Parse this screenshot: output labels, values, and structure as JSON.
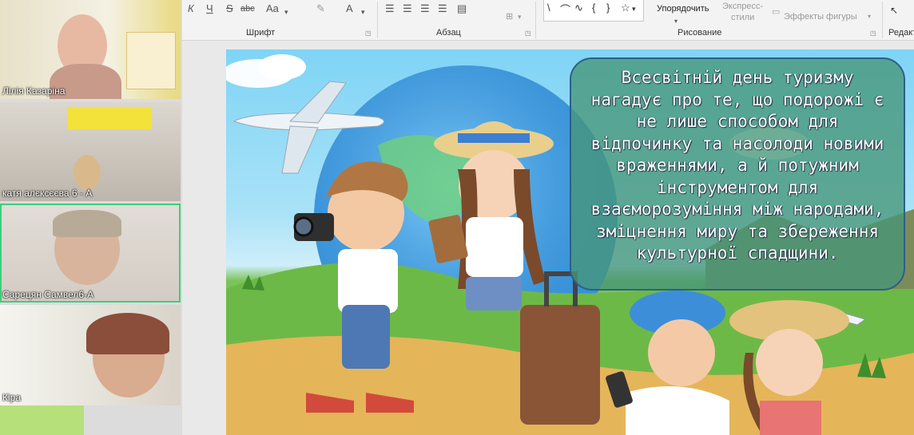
{
  "ribbon": {
    "font_group": "Шрифт",
    "paragraph_group": "Абзац",
    "drawing_group": "Рисование",
    "editing_group": "Редакт",
    "arrange_label": "Упорядочить",
    "quick_styles_label": "Экспресс-\nстили",
    "shape_effects_label": "Эффекты фигуры",
    "font_tools": [
      "К",
      "Ч",
      "S",
      "abc",
      "Aa",
      "A"
    ]
  },
  "participants": [
    {
      "name": "Лілія Казаріна"
    },
    {
      "name": "катя алєксєєва 6 - А"
    },
    {
      "name": "Сарецян Самвел6-А"
    },
    {
      "name": "Кіра"
    }
  ],
  "slide": {
    "text": "Всесвітній день туризму нагадує про те, що подорожі є не лише способом для відпочинку та насолоди новими враженнями, а й потужним інструментом для взаєморозуміння між народами, зміцнення миру та збереження культурної спадщини."
  }
}
